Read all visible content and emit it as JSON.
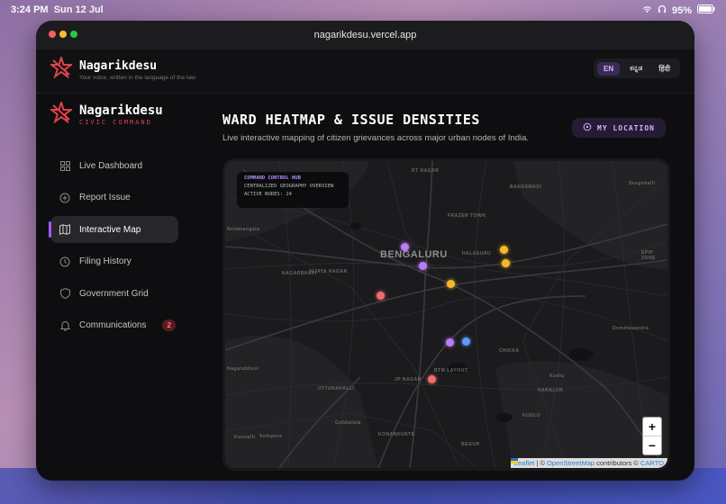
{
  "status_bar": {
    "time": "3:24 PM",
    "date": "Sun 12 Jul",
    "battery": "95%",
    "icons": [
      "wifi-icon",
      "headphones-icon",
      "battery-icon"
    ]
  },
  "browser": {
    "url": "nagarikdesu.vercel.app"
  },
  "header": {
    "brand": "Nagarikdesu",
    "tagline": "Your voice, written in the language of the law.",
    "languages": [
      {
        "label": "EN",
        "active": true
      },
      {
        "label": "ಕನ್ನಡ",
        "active": false
      },
      {
        "label": "हिंदी",
        "active": false
      }
    ]
  },
  "sidebar": {
    "brand": "Nagarikdesu",
    "brand_sub": "CIVIC COMMAND",
    "items": [
      {
        "label": "Live Dashboard",
        "icon": "grid-icon",
        "active": false
      },
      {
        "label": "Report Issue",
        "icon": "plus-circle-icon",
        "active": false
      },
      {
        "label": "Interactive Map",
        "icon": "map-icon",
        "active": true
      },
      {
        "label": "Filing History",
        "icon": "clock-icon",
        "active": false
      },
      {
        "label": "Government Grid",
        "icon": "shield-icon",
        "active": false
      },
      {
        "label": "Communications",
        "icon": "bell-icon",
        "active": false,
        "badge": "2"
      }
    ]
  },
  "main": {
    "title": "WARD HEATMAP & ISSUE DENSITIES",
    "subtitle": "Live interactive mapping of citizen grievances across major urban nodes of India.",
    "location_button": "MY LOCATION"
  },
  "map": {
    "hub": {
      "title": "COMMAND CONTROL HUB",
      "line1": "CENTRALIZED GEOGRAPHY OVERVIEW",
      "line2": "ACTIVE NODES: 24"
    },
    "city_label": "BENGALURU",
    "place_labels": [
      "RT NAGAR",
      "BANASWADI",
      "Seegehalli",
      "FRAZER TOWN",
      "HALASURU",
      "NAGARBHAVI",
      "VIJAYA NAGAR",
      "EPIP ZONE",
      "BTM LAYOUT",
      "JP NAGAR",
      "UTTARAHALLI",
      "Kudlu",
      "HARALUR",
      "Nelamangala",
      "Nagarabhavi",
      "Dommasandra",
      "Kannalli",
      "KONANKUNTE",
      "BEGUR",
      "Gubbalala",
      "Sompura",
      "KUDLU",
      "CHIKKA"
    ],
    "markers": [
      {
        "color": "#b87cf6",
        "type": "purple"
      },
      {
        "color": "#b87cf6",
        "type": "purple"
      },
      {
        "color": "#f5b829",
        "type": "yellow"
      },
      {
        "color": "#f5b829",
        "type": "yellow"
      },
      {
        "color": "#f5b829",
        "type": "yellow"
      },
      {
        "color": "#f26b6b",
        "type": "red"
      },
      {
        "color": "#b87cf6",
        "type": "purple"
      },
      {
        "color": "#5b9cf5",
        "type": "blue"
      },
      {
        "color": "#f26b6b",
        "type": "red"
      }
    ],
    "zoom_in": "+",
    "zoom_out": "−",
    "attribution": {
      "leaflet": "Leaflet",
      "sep": " | © ",
      "osm": "OpenStreetMap",
      "contributors": " contributors © ",
      "carto": "CARTO"
    }
  }
}
